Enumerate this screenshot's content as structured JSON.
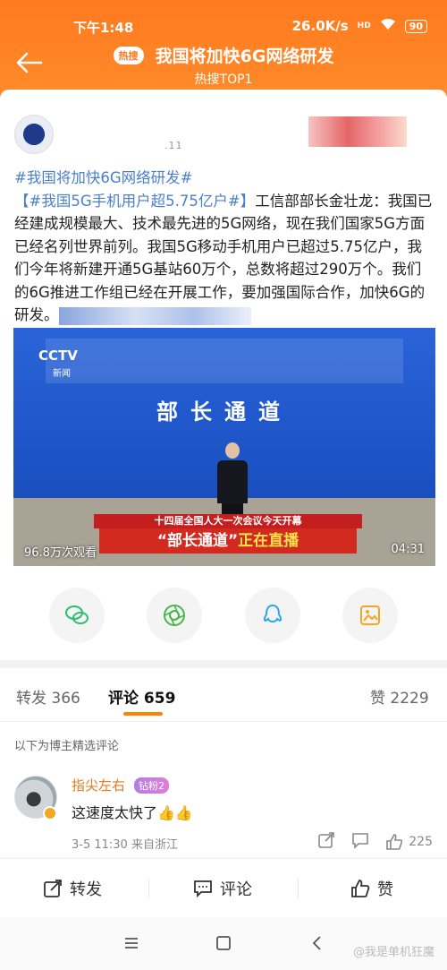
{
  "status_bar": {
    "time": "下午1:48",
    "network_speed": "26.0K/s",
    "signal": "HD",
    "battery": "90"
  },
  "header": {
    "badge": "热搜",
    "title": "我国将加快6G网络研发",
    "subtitle": "热搜TOP1"
  },
  "post": {
    "time_fragment": ".11",
    "tag1": "#我国将加快6G网络研发#",
    "tag2": "【#我国5G手机用户超5.75亿户#】",
    "body": "工信部部长金壮龙：我国已经建成规模最大、技术最先进的5G网络，现在我们国家5G方面已经名列世界前列。我国5G移动手机用户已超过5.75亿户，我们今年将新建开通5G基站60万个，总数将超过290万个。我们的6G推进工作组已经在开展工作，要加强国际合作，加快6G的研发。"
  },
  "video": {
    "channel_logo": "CCTV",
    "channel_sub": "新闻",
    "headline": "部长通道",
    "ticker": "十四届全国人大一次会议今天开幕",
    "banner_quote": "“部长通道”",
    "banner_rest": "正在直播",
    "views": "96.8万次观看",
    "duration": "04:31"
  },
  "share": {
    "icons": [
      "wechat-icon",
      "moments-icon",
      "qq-icon",
      "save-image-icon"
    ]
  },
  "tabs": [
    {
      "label": "转发",
      "count": "366"
    },
    {
      "label": "评论",
      "count": "659"
    },
    {
      "label": "赞",
      "count": "2229"
    }
  ],
  "curated_note": "以下为博主精选评论",
  "comment": {
    "username": "指尖左右",
    "fan_badge": "钻粉2",
    "text": "这速度太快了👍👍",
    "meta": "3-5 11:30 来自浙江",
    "likes": "225"
  },
  "actions": {
    "repost": "转发",
    "comment": "评论",
    "like": "赞"
  },
  "watermark": "@我是单机狂魔"
}
